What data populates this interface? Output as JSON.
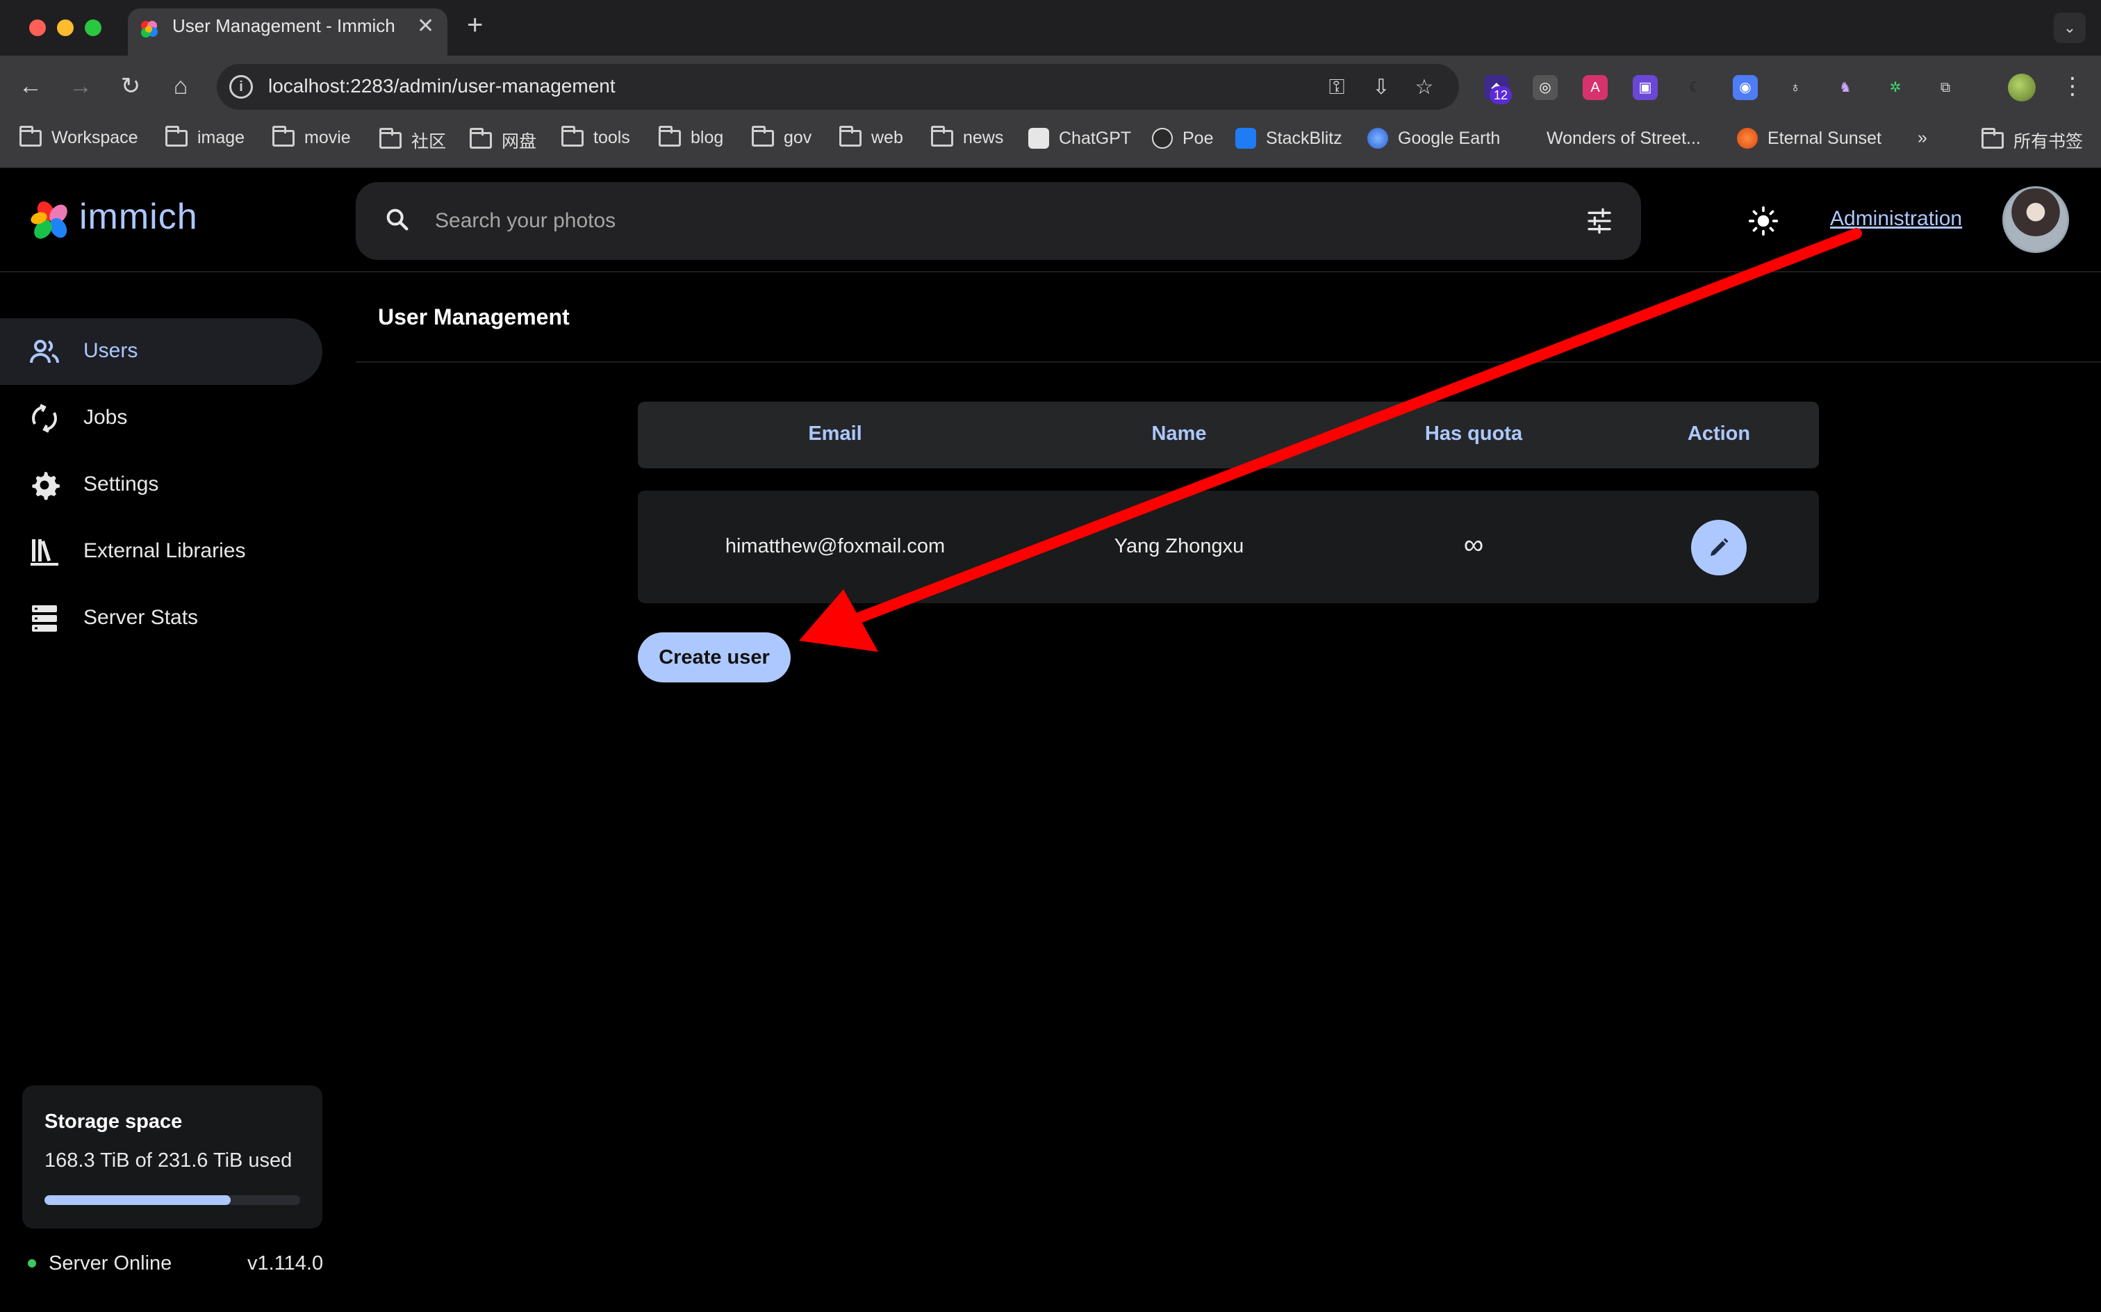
{
  "browser": {
    "tab_title": "User Management - Immich",
    "url": "localhost:2283/admin/user-management",
    "extension_badge": "12",
    "bookmarks": [
      {
        "label": "Workspace",
        "type": "folder"
      },
      {
        "label": "image",
        "type": "folder"
      },
      {
        "label": "movie",
        "type": "folder"
      },
      {
        "label": "社区",
        "type": "folder"
      },
      {
        "label": "网盘",
        "type": "folder"
      },
      {
        "label": "tools",
        "type": "folder"
      },
      {
        "label": "blog",
        "type": "folder"
      },
      {
        "label": "gov",
        "type": "folder"
      },
      {
        "label": "web",
        "type": "folder"
      },
      {
        "label": "news",
        "type": "folder"
      },
      {
        "label": "ChatGPT",
        "type": "site"
      },
      {
        "label": "Poe",
        "type": "site"
      },
      {
        "label": "StackBlitz",
        "type": "site"
      },
      {
        "label": "Google Earth",
        "type": "site"
      },
      {
        "label": "Wonders of Street...",
        "type": "site"
      },
      {
        "label": "Eternal Sunset",
        "type": "site"
      }
    ],
    "all_bookmarks": "所有书签",
    "overflow": "»"
  },
  "app": {
    "logo_text": "immich",
    "search_placeholder": "Search your photos",
    "admin_link": "Administration",
    "accent_color": "#adc8ff"
  },
  "sidebar": {
    "items": [
      {
        "label": "Users",
        "icon": "users-icon",
        "active": true
      },
      {
        "label": "Jobs",
        "icon": "sync-icon"
      },
      {
        "label": "Settings",
        "icon": "gear-icon"
      },
      {
        "label": "External Libraries",
        "icon": "library-icon"
      },
      {
        "label": "Server Stats",
        "icon": "server-icon"
      }
    ],
    "storage": {
      "title": "Storage space",
      "usage": "168.3 TiB of 231.6 TiB used",
      "fill_fraction": 0.727
    },
    "server_status": "Server Online",
    "version": "v1.114.0"
  },
  "main": {
    "title": "User Management",
    "table": {
      "headers": [
        "Email",
        "Name",
        "Has quota",
        "Action"
      ],
      "rows": [
        {
          "email": "himatthew@foxmail.com",
          "name": "Yang Zhongxu",
          "quota": "∞"
        }
      ]
    },
    "create_button": "Create user"
  },
  "annotation": {
    "arrow_color": "#ff0000"
  }
}
